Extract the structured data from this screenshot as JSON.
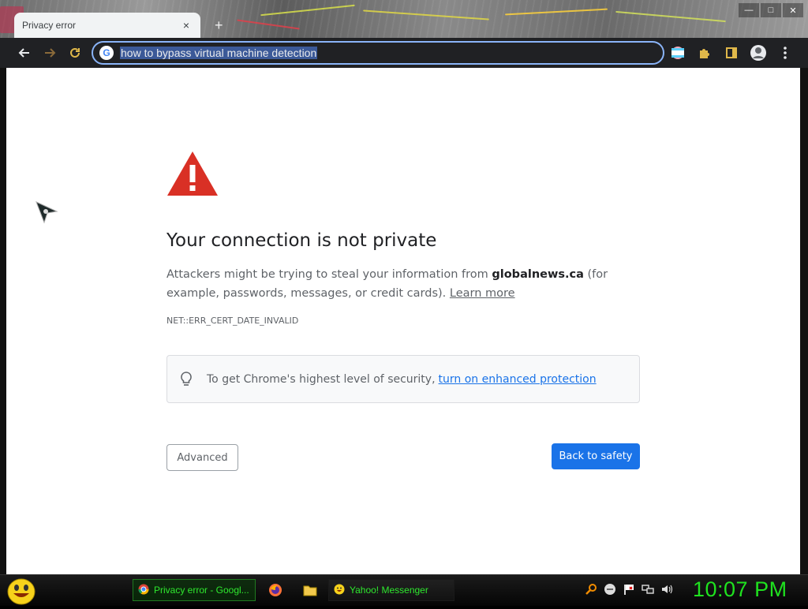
{
  "browser": {
    "tab": {
      "title": "Privacy error",
      "close": "×"
    },
    "new_tab": "+",
    "window_controls": {
      "minimize": "—",
      "maximize": "□",
      "close": "✕"
    },
    "omnibox": {
      "search_engine": "G",
      "value": "how to bypass virtual machine detection"
    },
    "accent": "#8ab4f8"
  },
  "page": {
    "heading": "Your connection is not private",
    "description_prefix": "Attackers might be trying to steal your information from ",
    "domain": "globalnews.ca",
    "description_suffix": " (for example, passwords, messages, or credit cards).",
    "learn_more": "Learn more",
    "error_code": "NET::ERR_CERT_DATE_INVALID",
    "security_text": "To get Chrome's highest level of security,",
    "security_link": "turn on enhanced protection",
    "advanced_button": "Advanced",
    "back_button": "Back to safety",
    "colors": {
      "warning": "#d93025",
      "primary": "#1a73e8"
    }
  },
  "taskbar": {
    "tasks": [
      {
        "label": "Privacy error - Googl...",
        "icon": "chrome-icon"
      },
      {
        "label": "Yahoo! Messenger",
        "icon": "yahoo-smiley-icon"
      }
    ],
    "quick_launch": [
      "firefox-icon",
      "folder-icon"
    ],
    "tray": [
      "search-icon",
      "messenger-status-icon",
      "flag-icon",
      "network-icon",
      "volume-icon"
    ],
    "clock": "10:07 PM",
    "clock_color": "#1fe21f"
  }
}
